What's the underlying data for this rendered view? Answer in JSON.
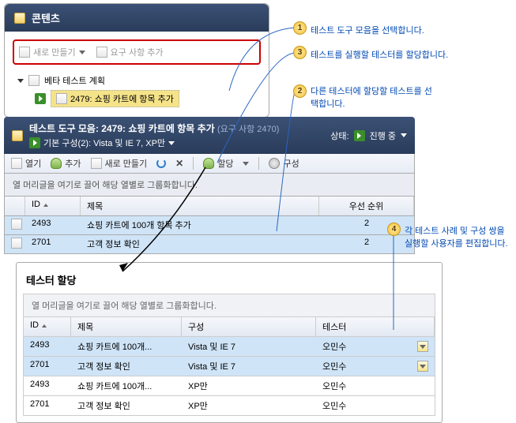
{
  "contents_panel": {
    "title": "콘텐츠",
    "new_button": "새로 만들기",
    "add_req_button": "요구 사항 추가",
    "tree": {
      "plan_label": "베타 테스트 계획",
      "suite_label": "2479: 쇼핑 카트에 항목 추가"
    }
  },
  "suite_panel": {
    "title_prefix": "테스트 도구 모음:",
    "title_main": "2479: 쇼핑 카트에 항목 추가",
    "req_text": "(요구 사항 2470)",
    "config_label": "기본 구성(2): Vista 및 IE 7, XP만",
    "status_label": "상태:",
    "status_value": "진행 중",
    "toolbar": {
      "open": "열기",
      "add": "추가",
      "new": "새로 만들기",
      "assign": "할당",
      "config": "구성"
    },
    "group_hint": "열 머리글을 여기로 끌어 해당 열별로 그룹화합니다.",
    "columns": {
      "id": "ID",
      "title": "제목",
      "priority": "우선 순위"
    },
    "rows": [
      {
        "id": "2493",
        "title": "쇼핑 카트에 100개 항목 추가",
        "priority": "2"
      },
      {
        "id": "2701",
        "title": "고객 정보 확인",
        "priority": "2"
      }
    ]
  },
  "assign_panel": {
    "title": "테스터 할당",
    "group_hint": "열 머리글을 여기로 끌어 해당 열별로 그룹화합니다.",
    "columns": {
      "id": "ID",
      "title": "제목",
      "config": "구성",
      "tester": "테스터"
    },
    "rows": [
      {
        "id": "2493",
        "title": "쇼핑 카트에 100개...",
        "config": "Vista 및 IE 7",
        "tester": "오민수",
        "highlighted": true,
        "dropdown": true
      },
      {
        "id": "2701",
        "title": "고객 정보 확인",
        "config": "Vista 및 IE 7",
        "tester": "오민수",
        "highlighted": true,
        "dropdown": true
      },
      {
        "id": "2493",
        "title": "쇼핑 카트에 100개...",
        "config": "XP만",
        "tester": "오민수",
        "highlighted": false,
        "dropdown": false
      },
      {
        "id": "2701",
        "title": "고객 정보 확인",
        "config": "XP만",
        "tester": "오민수",
        "highlighted": false,
        "dropdown": false
      }
    ]
  },
  "callouts": {
    "1": "테스트 도구 모음을 선택합니다.",
    "2": "다른 테스터에 할당할 테스트를 선택합니다.",
    "3": "테스트를 실행할 테스터를 할당합니다.",
    "4": "각 테스트 사례 및 구성 쌍을 실행할 사용자를 편집합니다."
  }
}
